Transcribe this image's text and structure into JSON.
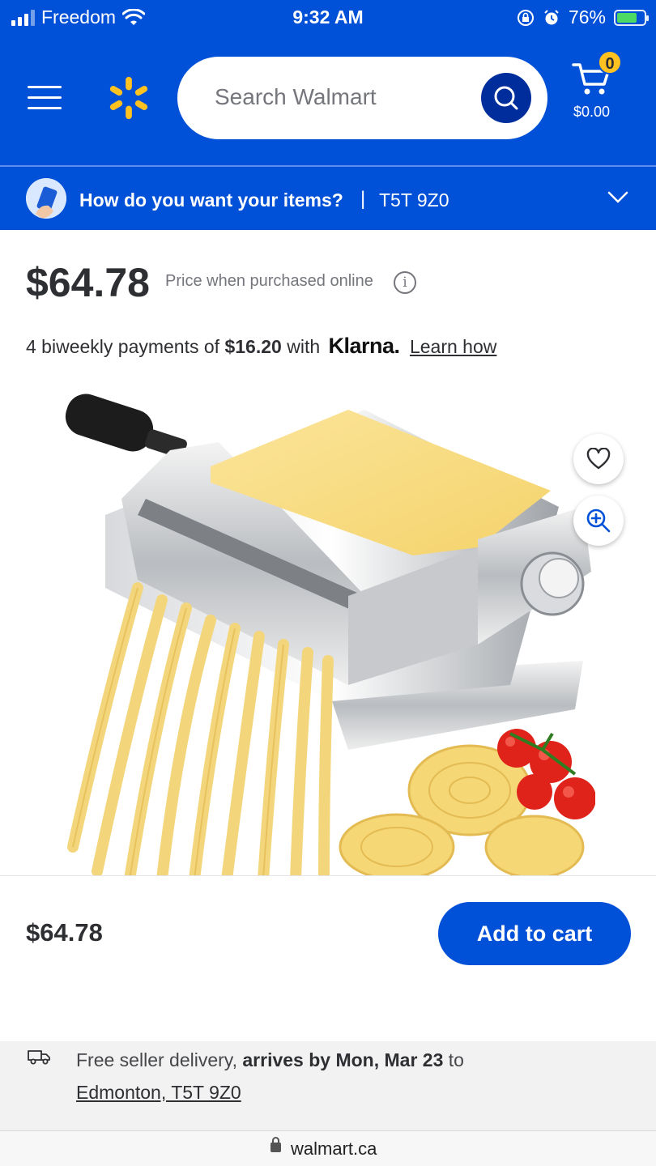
{
  "status_bar": {
    "carrier": "Freedom",
    "time": "9:32 AM",
    "battery": "76%",
    "battery_level": 0.76
  },
  "header": {
    "search_placeholder": "Search Walmart",
    "cart_count": "0",
    "cart_total": "$0.00",
    "brand_color": "#0050d8",
    "spark_color": "#ffc220"
  },
  "delivery_bar": {
    "question": "How do you want your items?",
    "separator": "|",
    "postal_code": "T5T 9Z0"
  },
  "product": {
    "price": "$64.78",
    "price_note": "Price when purchased online",
    "installment_prefix": "4 biweekly payments of",
    "installment_amount": "$16.20",
    "installment_with": "with",
    "klarna": "Klarna.",
    "learn_how": "Learn how"
  },
  "sticky_bar": {
    "price": "$64.78",
    "add_to_cart": "Add to cart"
  },
  "shipping": {
    "prefix": "Free seller delivery,",
    "arrival": "arrives by Mon, Mar 23",
    "suffix": "to",
    "location": "Edmonton, T5T 9Z0"
  },
  "browser": {
    "url": "walmart.ca"
  }
}
